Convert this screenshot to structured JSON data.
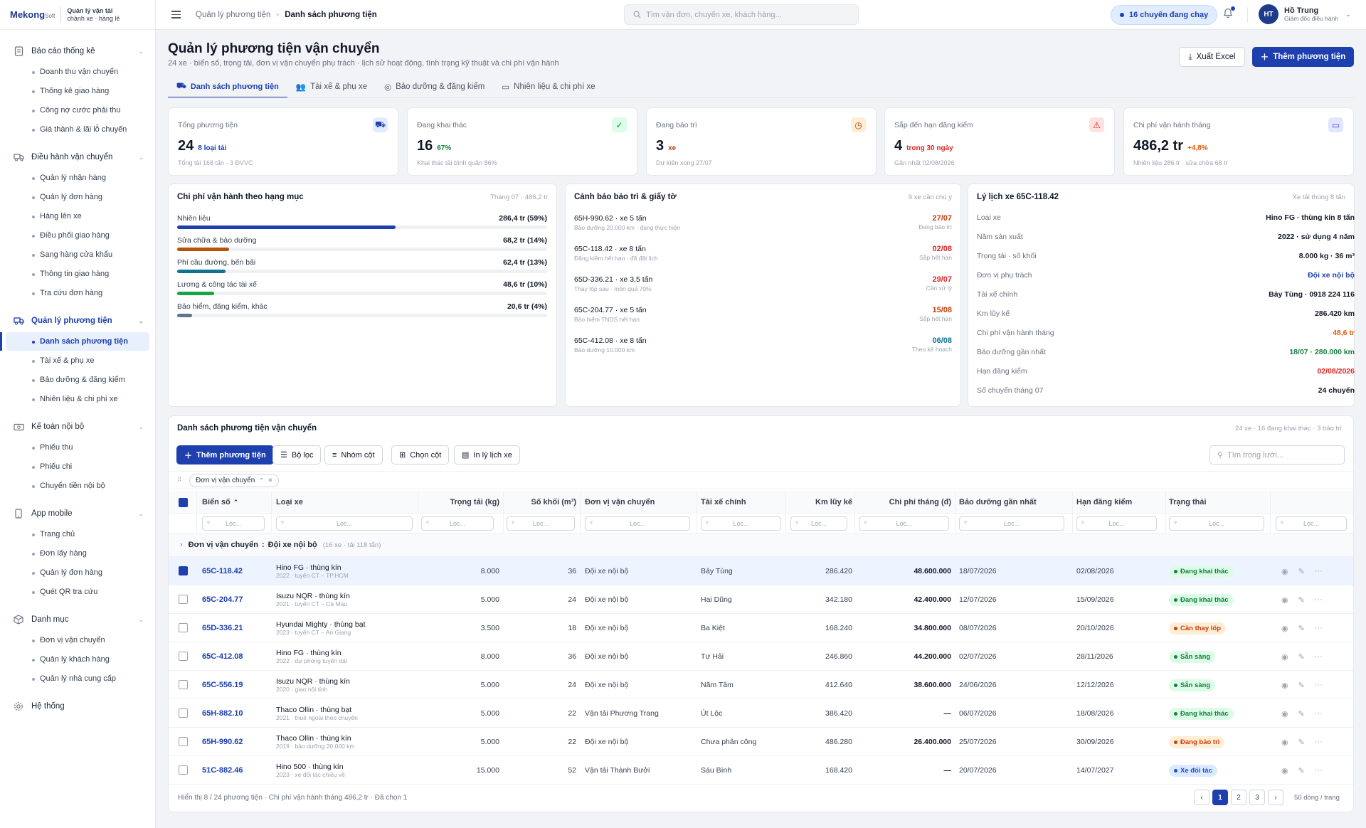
{
  "brand": {
    "logo": "Mekong",
    "logo_suffix": "Soft",
    "sub_title": "Quản lý vận tải",
    "sub_caption": "chành xe · hàng lẻ"
  },
  "sidebar": {
    "groups": [
      {
        "label": "Báo cáo thống kê",
        "icon": "report-icon",
        "items": [
          "Doanh thu vận chuyển",
          "Thống kê giao hàng",
          "Công nợ cước phải thu",
          "Giá thành & lãi lỗ chuyến"
        ]
      },
      {
        "label": "Điều hành vận chuyển",
        "icon": "truck-icon",
        "items": [
          "Quản lý nhận hàng",
          "Quản lý đơn hàng",
          "Hàng lên xe",
          "Điều phối giao hàng",
          "Sang hàng cửa khẩu",
          "Thông tin giao hàng",
          "Tra cứu đơn hàng"
        ]
      },
      {
        "label": "Quản lý phương tiện",
        "icon": "vehicle-icon",
        "items": [
          "Danh sách phương tiện",
          "Tài xế & phụ xe",
          "Bảo dưỡng & đăng kiểm",
          "Nhiên liệu & chi phí xe"
        ]
      },
      {
        "label": "Kế toán nội bộ",
        "icon": "cash-icon",
        "items": [
          "Phiếu thu",
          "Phiếu chi",
          "Chuyển tiền nội bộ"
        ]
      },
      {
        "label": "App mobile",
        "icon": "phone-icon",
        "items": [
          "Trang chủ",
          "Đơn lấy hàng",
          "Quản lý đơn hàng",
          "Quét QR tra cứu"
        ]
      },
      {
        "label": "Danh mục",
        "icon": "box-icon",
        "items": [
          "Đơn vị vận chuyển",
          "Quản lý khách hàng",
          "Quản lý nhà cung cấp"
        ]
      },
      {
        "label": "Hệ thống",
        "icon": "gear-icon",
        "items": []
      }
    ]
  },
  "header": {
    "breadcrumb_parent": "Quản lý phương tiện",
    "breadcrumb_current": "Danh sách phương tiện",
    "search_placeholder": "Tìm vận đơn, chuyến xe, khách hàng...",
    "running_pill": "16 chuyến đang chạy",
    "user_initials": "HT",
    "user_name": "Hồ Trung",
    "user_role": "Giám đốc điều hành"
  },
  "page": {
    "title": "Quản lý phương tiện vận chuyển",
    "subtitle": "24 xe · biển số, trọng tải, đơn vị vận chuyển phụ trách · lịch sử hoạt động, tình trạng kỹ thuật và chi phí vận hành",
    "export_label": "Xuất Excel",
    "add_label": "Thêm phương tiện",
    "tabs": [
      "Danh sách phương tiện",
      "Tài xế & phụ xe",
      "Bảo dưỡng & đăng kiểm",
      "Nhiên liệu & chi phí xe"
    ]
  },
  "kpis": [
    {
      "label": "Tổng phương tiện",
      "value": "24",
      "extra": "8 loại tải",
      "note": "Tổng tải 168 tấn · 3 ĐVVC",
      "color": "#1e40af",
      "bg": "#e0ecff",
      "icon": "truck-icon"
    },
    {
      "label": "Đang khai thác",
      "value": "16",
      "extra": "67%",
      "note": "Khai thác tải bình quân 86%",
      "color": "#15803d",
      "bg": "#dcfce7",
      "icon": "check-circle-icon"
    },
    {
      "label": "Đang bảo trì",
      "value": "3",
      "extra": "xe",
      "note": "Dự kiến xong 27/07",
      "color": "#c2410c",
      "bg": "#ffedd5",
      "icon": "clock-icon"
    },
    {
      "label": "Sắp đến hạn đăng kiểm",
      "value": "4",
      "extra": "trong 30 ngày",
      "note": "Gần nhất 02/08/2026",
      "color": "#dc2626",
      "bg": "#fee2e2",
      "icon": "alert-icon"
    },
    {
      "label": "Chi phí vận hành tháng",
      "value": "486,2 tr",
      "extra": "+4,8%",
      "note": "Nhiên liệu 286 tr · sửa chữa 68 tr",
      "color": "#ea580c",
      "bg": "#e0e7ff",
      "icon": "card-icon"
    }
  ],
  "cost_panel": {
    "title": "Chi phí vận hành theo hạng mục",
    "right": "Tháng 07 · 486,2 tr",
    "rows": [
      {
        "label": "Nhiên liệu",
        "value": "286,4 tr (59%)",
        "pct": 59,
        "color": "#1e40af"
      },
      {
        "label": "Sửa chữa & bảo dưỡng",
        "value": "68,2 tr (14%)",
        "pct": 14,
        "color": "#b45309"
      },
      {
        "label": "Phí cầu đường, bến bãi",
        "value": "62,4 tr (13%)",
        "pct": 13,
        "color": "#0e7490"
      },
      {
        "label": "Lương & công tác tài xế",
        "value": "48,6 tr (10%)",
        "pct": 10,
        "color": "#16a34a"
      },
      {
        "label": "Bảo hiểm, đăng kiểm, khác",
        "value": "20,6 tr (4%)",
        "pct": 4,
        "color": "#64748b"
      }
    ]
  },
  "warn_panel": {
    "title": "Cảnh báo bảo trì & giấy tờ",
    "right": "9 xe cần chú ý",
    "rows": [
      {
        "title": "65H-990.62 · xe 5 tấn",
        "sub": "Bảo dưỡng 20.000 km · đang thực hiện",
        "date": "27/07",
        "date_sub": "Đang bảo trì",
        "color": "#c2410c"
      },
      {
        "title": "65C-118.42 · xe 8 tấn",
        "sub": "Đăng kiểm hết hạn · đã đặt lịch",
        "date": "02/08",
        "date_sub": "Sắp hết hạn",
        "color": "#dc2626"
      },
      {
        "title": "65D-336.21 · xe 3,5 tấn",
        "sub": "Thay lốp sau · mòn quá 70%",
        "date": "29/07",
        "date_sub": "Cần xử lý",
        "color": "#dc2626"
      },
      {
        "title": "65C-204.77 · xe 5 tấn",
        "sub": "Bảo hiểm TNDS hết hạn",
        "date": "15/08",
        "date_sub": "Sắp hết hạn",
        "color": "#c2410c"
      },
      {
        "title": "65C-412.08 · xe 8 tấn",
        "sub": "Bảo dưỡng 10.000 km",
        "date": "06/08",
        "date_sub": "Theo kế hoạch",
        "color": "#0e7490"
      }
    ]
  },
  "history_panel": {
    "title": "Lý lịch xe 65C-118.42",
    "right": "Xe tải thùng 8 tấn",
    "rows": [
      {
        "label": "Loại xe",
        "value": "Hino FG · thùng kín 8 tấn",
        "color": "#111827"
      },
      {
        "label": "Năm sản xuất",
        "value": "2022 · sử dụng 4 năm",
        "color": "#111827"
      },
      {
        "label": "Trọng tải · số khối",
        "value": "8.000 kg · 36 m³",
        "color": "#111827"
      },
      {
        "label": "Đơn vị phụ trách",
        "value": "Đội xe nội bộ",
        "color": "#1e40af"
      },
      {
        "label": "Tài xế chính",
        "value": "Bảy Tùng · 0918 224 116",
        "color": "#111827"
      },
      {
        "label": "Km lũy kế",
        "value": "286.420 km",
        "color": "#111827"
      },
      {
        "label": "Chi phí vận hành tháng",
        "value": "48,6 tr",
        "color": "#ea580c"
      },
      {
        "label": "Bảo dưỡng gần nhất",
        "value": "18/07 · 280.000 km",
        "color": "#15803d"
      },
      {
        "label": "Hạn đăng kiểm",
        "value": "02/08/2026",
        "color": "#dc2626"
      },
      {
        "label": "Số chuyến tháng 07",
        "value": "24 chuyến",
        "color": "#111827"
      }
    ]
  },
  "table_panel": {
    "title": "Danh sách phương tiện vận chuyển",
    "right": "24 xe · 16 đang khai thác · 3 bảo trì",
    "add_label": "Thêm phương tiện",
    "filter_label": "Bộ lọc",
    "group_label": "Nhóm cột",
    "columns_label": "Chọn cột",
    "print_label": "In lý lịch xe",
    "search_placeholder": "Tìm trong lưới...",
    "group_chip": "Đơn vị vận chuyển",
    "filter_placeholder": "Lọc...",
    "headers": [
      "Biển số",
      "Loại xe",
      "Trọng tải (kg)",
      "Số khối (m³)",
      "Đơn vị vận chuyển",
      "Tài xế chính",
      "Km lũy kế",
      "Chi phí tháng (đ)",
      "Bảo dưỡng gần nhất",
      "Hạn đăng kiểm",
      "Trạng thái"
    ],
    "group_row_label": "Đơn vị vận chuyển",
    "group_row_value": "Đội xe nội bộ",
    "group_row_meta": "(16 xe · tải 118 tấn)",
    "rows": [
      {
        "plate": "65C-118.42",
        "type": "Hino FG · thùng kín",
        "type_sub": "2022 · tuyến CT – TP.HCM",
        "load": "8.000",
        "vol": "36",
        "unit": "Đội xe nội bộ",
        "driver": "Bảy Tùng",
        "km": "286.420",
        "cost": "48.600.000",
        "maint": "18/07/2026",
        "reg": "02/08/2026",
        "status": "Đang khai thác",
        "tone": "green",
        "checked": true
      },
      {
        "plate": "65C-204.77",
        "type": "Isuzu NQR · thùng kín",
        "type_sub": "2021 · tuyến CT – Cà Mau",
        "load": "5.000",
        "vol": "24",
        "unit": "Đội xe nội bộ",
        "driver": "Hai Dũng",
        "km": "342.180",
        "cost": "42.400.000",
        "maint": "12/07/2026",
        "reg": "15/09/2026",
        "status": "Đang khai thác",
        "tone": "green",
        "checked": false
      },
      {
        "plate": "65D-336.21",
        "type": "Hyundai Mighty · thùng bạt",
        "type_sub": "2023 · tuyến CT – An Giang",
        "load": "3.500",
        "vol": "18",
        "unit": "Đội xe nội bộ",
        "driver": "Ba Kiệt",
        "km": "168.240",
        "cost": "34.800.000",
        "maint": "08/07/2026",
        "reg": "20/10/2026",
        "status": "Cần thay lốp",
        "tone": "orange",
        "checked": false
      },
      {
        "plate": "65C-412.08",
        "type": "Hino FG · thùng kín",
        "type_sub": "2022 · dự phòng tuyến dài",
        "load": "8.000",
        "vol": "36",
        "unit": "Đội xe nội bộ",
        "driver": "Tư Hải",
        "km": "246.860",
        "cost": "44.200.000",
        "maint": "02/07/2026",
        "reg": "28/11/2026",
        "status": "Sẵn sàng",
        "tone": "green",
        "checked": false
      },
      {
        "plate": "65C-556.19",
        "type": "Isuzu NQR · thùng kín",
        "type_sub": "2020 · giao nội tỉnh",
        "load": "5.000",
        "vol": "24",
        "unit": "Đội xe nội bộ",
        "driver": "Năm Tâm",
        "km": "412.640",
        "cost": "38.600.000",
        "maint": "24/06/2026",
        "reg": "12/12/2026",
        "status": "Sẵn sàng",
        "tone": "green",
        "checked": false
      },
      {
        "plate": "65H-882.10",
        "type": "Thaco Ollin · thùng bạt",
        "type_sub": "2021 · thuê ngoài theo chuyến",
        "load": "5.000",
        "vol": "22",
        "unit": "Vận tải Phương Trang",
        "driver": "Út Lộc",
        "km": "386.420",
        "cost": "—",
        "maint": "06/07/2026",
        "reg": "18/08/2026",
        "status": "Đang khai thác",
        "tone": "green",
        "checked": false
      },
      {
        "plate": "65H-990.62",
        "type": "Thaco Ollin · thùng kín",
        "type_sub": "2019 · bảo dưỡng 20.000 km",
        "load": "5.000",
        "vol": "22",
        "unit": "Đội xe nội bộ",
        "driver": "Chưa phân công",
        "km": "486.280",
        "cost": "26.400.000",
        "maint": "25/07/2026",
        "reg": "30/09/2026",
        "status": "Đang bảo trì",
        "tone": "orange",
        "checked": false
      },
      {
        "plate": "51C-882.46",
        "type": "Hino 500 · thùng kín",
        "type_sub": "2023 · xe đối tác chiều về",
        "load": "15.000",
        "vol": "52",
        "unit": "Vận tải Thành Bưởi",
        "driver": "Sáu Bình",
        "km": "168.420",
        "cost": "—",
        "maint": "20/07/2026",
        "reg": "14/07/2027",
        "status": "Xe đối tác",
        "tone": "blue",
        "checked": false
      }
    ],
    "footer": "Hiển thị 8 / 24 phương tiện · Chi phí vận hành tháng 486,2 tr · Đã chọn 1",
    "pages": [
      "1",
      "2",
      "3"
    ],
    "per_page": "50 dòng / trang"
  }
}
